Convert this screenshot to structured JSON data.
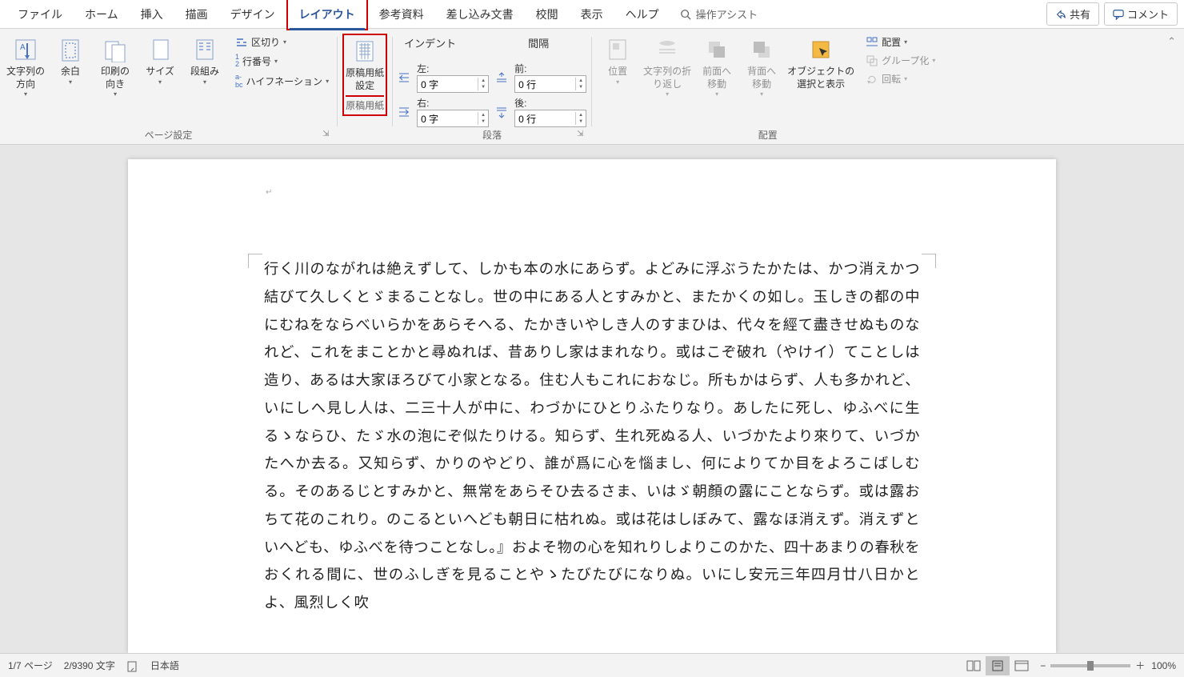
{
  "menu": {
    "tabs": [
      "ファイル",
      "ホーム",
      "挿入",
      "描画",
      "デザイン",
      "レイアウト",
      "参考資料",
      "差し込み文書",
      "校閲",
      "表示",
      "ヘルプ"
    ],
    "active_index": 5,
    "tell_me": "操作アシスト",
    "share": "共有",
    "comments": "コメント"
  },
  "ribbon": {
    "page_setup": {
      "label": "ページ設定",
      "text_direction": "文字列の\n方向",
      "margins": "余白",
      "orientation": "印刷の\n向き",
      "size": "サイズ",
      "columns": "段組み",
      "breaks": "区切り",
      "line_numbers": "行番号",
      "hyphenation": "ハイフネーション"
    },
    "manuscript": {
      "group_label": "原稿用紙",
      "button": "原稿用紙\n設定"
    },
    "paragraph": {
      "label": "段落",
      "indent_header": "インデント",
      "spacing_header": "間隔",
      "indent_left_label": "左:",
      "indent_left_value": "0 字",
      "indent_right_label": "右:",
      "indent_right_value": "0 字",
      "spacing_before_label": "前:",
      "spacing_before_value": "0 行",
      "spacing_after_label": "後:",
      "spacing_after_value": "0 行"
    },
    "arrange": {
      "label": "配置",
      "position": "位置",
      "wrap_text": "文字列の折\nり返し",
      "bring_forward": "前面へ\n移動",
      "send_backward": "背面へ\n移動",
      "selection_pane": "オブジェクトの\n選択と表示",
      "align": "配置",
      "group": "グループ化",
      "rotate": "回転"
    }
  },
  "document": {
    "mark": "↵",
    "text": "行く川のながれは絶えずして、しかも本の水にあらず。よどみに浮ぶうたかたは、かつ消えかつ結びて久しくとゞまることなし。世の中にある人とすみかと、またかくの如し。玉しきの都の中にむねをならべいらかをあらそへる、たかきいやしき人のすまひは、代々を經て盡きせぬものなれど、これをまことかと尋ぬれば、昔ありし家はまれなり。或はこぞ破れ（やけイ）てことしは造り、あるは大家ほろびて小家となる。住む人もこれにおなじ。所もかはらず、人も多かれど、いにしへ見し人は、二三十人が中に、わづかにひとりふたりなり。あしたに死し、ゆふべに生るゝならひ、たゞ水の泡にぞ似たりける。知らず、生れ死ぬる人、いづかたより來りて、いづかたへか去る。又知らず、かりのやどり、誰が爲に心を惱まし、何によりてか目をよろこばしむる。そのあるじとすみかと、無常をあらそひ去るさま、いはゞ朝顏の露にことならず。或は露おちて花のこれり。のこるといへども朝日に枯れぬ。或は花はしぼみて、露なほ消えず。消えずといへども、ゆふべを待つことなし。』およそ物の心を知れりしよりこのかた、四十あまりの春秋をおくれる間に、世のふしぎを見ることやゝたびたびになりぬ。いにし安元三年四月廿八日かとよ、風烈しく吹"
  },
  "status": {
    "page": "1/7 ページ",
    "words": "2/9390 文字",
    "language": "日本語",
    "zoom": "100%"
  }
}
